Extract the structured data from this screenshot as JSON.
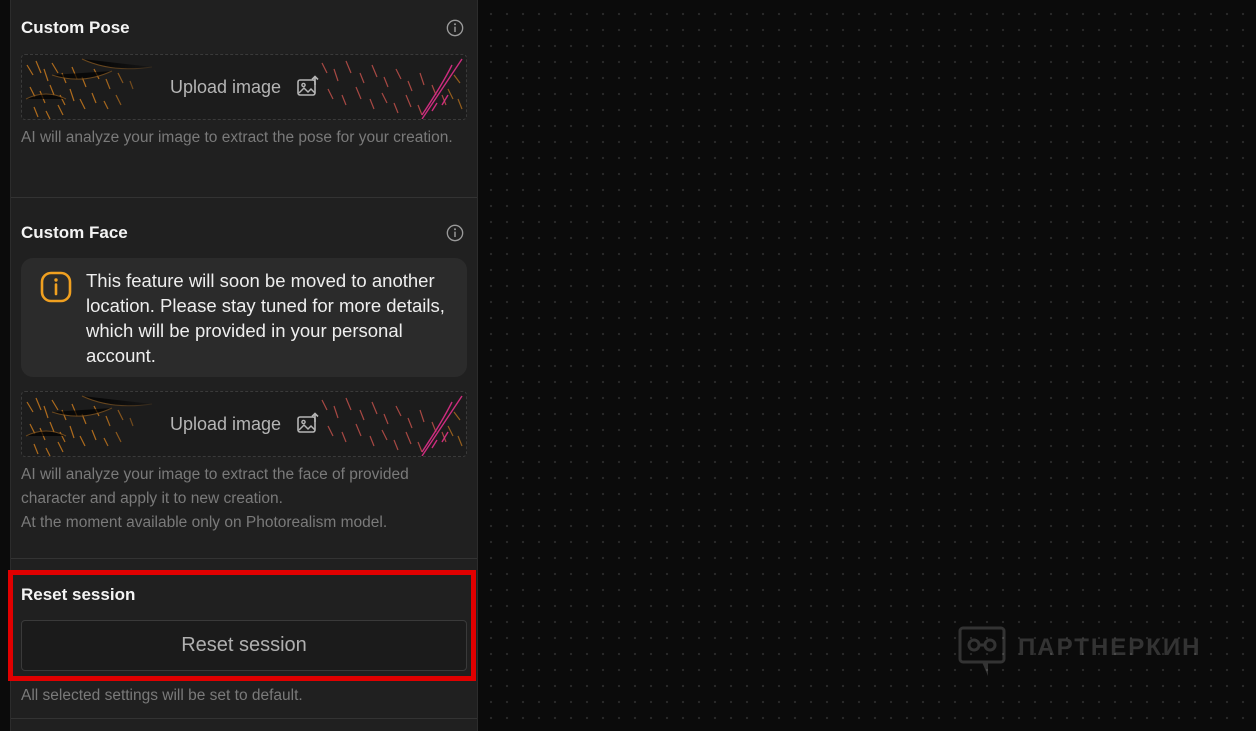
{
  "custom_pose": {
    "title": "Custom Pose",
    "upload_label": "Upload image",
    "helper": "AI will analyze your image to extract the pose for your creation."
  },
  "custom_face": {
    "title": "Custom Face",
    "notice": "This feature will soon be moved to another location. Please stay tuned for more details, which will be provided in your personal account.",
    "upload_label": "Upload image",
    "helper_line1": "AI will analyze your image to extract the face of provided character and apply it to new creation.",
    "helper_line2": "At the moment available only on Photorealism model."
  },
  "reset": {
    "title": "Reset session",
    "button_label": "Reset session",
    "helper": "All selected settings will be set to default."
  },
  "watermark": {
    "text": "ПАРТНЕРКИН"
  },
  "colors": {
    "panel_bg": "#202020",
    "canvas_bg": "#0b0b0b",
    "highlight": "#e00000",
    "warning": "#f0a020",
    "text_primary": "#f4f4f4",
    "text_muted": "#7a7a7a"
  },
  "icons": {
    "info": "info-circle-icon",
    "upload": "image-upload-icon",
    "warning": "warning-info-icon"
  }
}
